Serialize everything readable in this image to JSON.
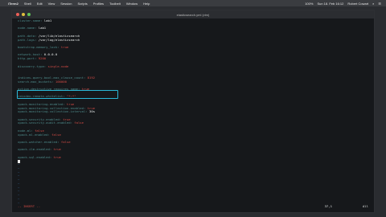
{
  "menubar": {
    "app": "iTerm2",
    "items": [
      "iTerm2",
      "Shell",
      "Edit",
      "View",
      "Session",
      "Scripts",
      "Profiles",
      "Toolbelt",
      "Window",
      "Help"
    ],
    "status": [
      "100%",
      "Sun 18. Feb 16:12",
      "Robert Cowart"
    ]
  },
  "window": {
    "title": "elasticsearch.yml (vim)"
  },
  "editor": {
    "lines": [
      {
        "key": "cluster.name:",
        "val": "lab1",
        "style": "v"
      },
      {
        "key": "",
        "val": "",
        "style": "v"
      },
      {
        "key": "node.name:",
        "val": "lab1",
        "style": "v"
      },
      {
        "key": "",
        "val": "",
        "style": "v"
      },
      {
        "key": "path.data:",
        "val": "/var/lib/elasticsearch",
        "style": "v"
      },
      {
        "key": "path.logs:",
        "val": "/var/log/elasticsearch",
        "style": "v"
      },
      {
        "key": "",
        "val": "",
        "style": "v"
      },
      {
        "key": "bootstrap.memory_lock:",
        "val": "true",
        "style": "vs"
      },
      {
        "key": "",
        "val": "",
        "style": "v"
      },
      {
        "key": "network.host:",
        "val": "0.0.0.0",
        "style": "v"
      },
      {
        "key": "http.port:",
        "val": "9200",
        "style": "vs"
      },
      {
        "key": "",
        "val": "",
        "style": "v"
      },
      {
        "key": "discovery.type:",
        "val": "single-node",
        "style": "vs"
      },
      {
        "key": "",
        "val": "",
        "style": "v"
      },
      {
        "key": "",
        "val": "",
        "style": "v"
      },
      {
        "key": "indices.query.bool.max_clause_count:",
        "val": "8192",
        "style": "vs"
      },
      {
        "key": "search.max_buckets:",
        "val": "100000",
        "style": "vs"
      },
      {
        "key": "",
        "val": "",
        "style": "v"
      },
      {
        "key": "action.destructive_requires_name:",
        "val": "true",
        "style": "vs"
      },
      {
        "key": "",
        "val": "",
        "style": "v"
      },
      {
        "key": "reindex.remote.whitelist:",
        "val": "\"*:*\"",
        "style": "vs"
      },
      {
        "key": "",
        "val": "",
        "style": "v"
      },
      {
        "key": "xpack.monitoring.enabled:",
        "val": "true",
        "style": "vs"
      },
      {
        "key": "xpack.monitoring.collection.enabled:",
        "val": "true",
        "style": "vs"
      },
      {
        "key": "xpack.monitoring.collection.interval:",
        "val": "30s",
        "style": "v"
      },
      {
        "key": "",
        "val": "",
        "style": "v"
      },
      {
        "key": "xpack.security.enabled:",
        "val": "true",
        "style": "vs"
      },
      {
        "key": "xpack.security.audit.enabled:",
        "val": "false",
        "style": "vs"
      },
      {
        "key": "",
        "val": "",
        "style": "v"
      },
      {
        "key": "node.ml:",
        "val": "false",
        "style": "vs"
      },
      {
        "key": "xpack.ml.enabled:",
        "val": "false",
        "style": "vs"
      },
      {
        "key": "",
        "val": "",
        "style": "v"
      },
      {
        "key": "xpack.watcher.enabled:",
        "val": "false",
        "style": "vs"
      },
      {
        "key": "",
        "val": "",
        "style": "v"
      },
      {
        "key": "xpack.ilm.enabled:",
        "val": "true",
        "style": "vs"
      },
      {
        "key": "",
        "val": "",
        "style": "v"
      },
      {
        "key": "xpack.sql.enabled:",
        "val": "true",
        "style": "vs"
      },
      {
        "key": "",
        "val": "",
        "style": "v"
      }
    ],
    "tildes": [
      "~",
      "~",
      "~",
      "~",
      "~",
      "~",
      "~",
      "~",
      "~",
      "~",
      "~",
      "~"
    ]
  },
  "statusline": {
    "mode": "-- INSERT --",
    "position": "37,1",
    "scroll": "All"
  },
  "colors": {
    "highlight_box": "#2ab7d6",
    "key": "#4e8b8b",
    "string": "#d04a44"
  }
}
